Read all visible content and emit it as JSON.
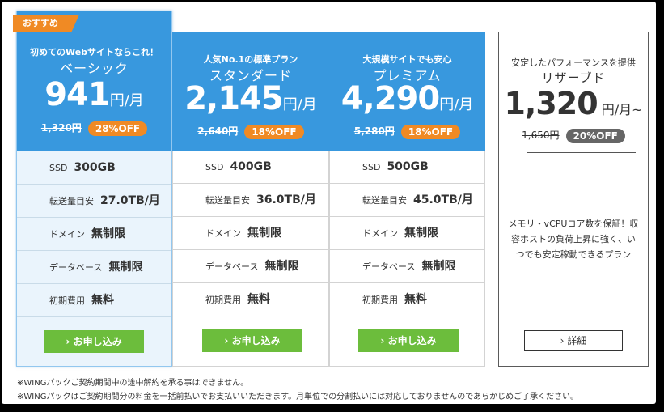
{
  "plans": [
    {
      "badge": "おすすめ",
      "tagline": "初めてのWebサイトならこれ！",
      "name": "ベーシック",
      "price": "941",
      "price_unit": "円/月",
      "old_price": "1,320円",
      "discount": "28%OFF",
      "specs": [
        {
          "label": "SSD",
          "value": "300GB"
        },
        {
          "label": "転送量目安",
          "value": "27.0TB/月"
        },
        {
          "label": "ドメイン",
          "value": "無制限"
        },
        {
          "label": "データベース",
          "value": "無制限"
        },
        {
          "label": "初期費用",
          "value": "無料"
        }
      ],
      "button": "お申し込み"
    },
    {
      "tagline": "人気No.1の標準プラン",
      "name": "スタンダード",
      "price": "2,145",
      "price_unit": "円/月",
      "old_price": "2,640円",
      "discount": "18%OFF",
      "specs": [
        {
          "label": "SSD",
          "value": "400GB"
        },
        {
          "label": "転送量目安",
          "value": "36.0TB/月"
        },
        {
          "label": "ドメイン",
          "value": "無制限"
        },
        {
          "label": "データベース",
          "value": "無制限"
        },
        {
          "label": "初期費用",
          "value": "無料"
        }
      ],
      "button": "お申し込み"
    },
    {
      "tagline": "大規模サイトでも安心",
      "name": "プレミアム",
      "price": "4,290",
      "price_unit": "円/月",
      "old_price": "5,280円",
      "discount": "18%OFF",
      "specs": [
        {
          "label": "SSD",
          "value": "500GB"
        },
        {
          "label": "転送量目安",
          "value": "45.0TB/月"
        },
        {
          "label": "ドメイン",
          "value": "無制限"
        },
        {
          "label": "データベース",
          "value": "無制限"
        },
        {
          "label": "初期費用",
          "value": "無料"
        }
      ],
      "button": "お申し込み"
    }
  ],
  "reserved": {
    "tagline": "安定したパフォーマンスを提供",
    "name": "リザーブド",
    "price": "1,320",
    "price_unit": "円/月~",
    "old_price": "1,650円",
    "discount": "20%OFF",
    "description": "メモリ・vCPUコア数を保証！収容ホストの負荷上昇に強く、いつでも安定稼動できるプラン",
    "button": "詳細"
  },
  "notes": [
    "※WINGパックご契約期間中の途中解約を承る事はできません。",
    "※WINGパックはご契約期間分の料金を一括前払いでお支払いいただきます。月単位での分割払いには対応しておりませんのであらかじめご了承ください。"
  ],
  "colors": {
    "header_blue": "#3898de",
    "discount_orange": "#f08a24",
    "apply_green": "#6cbd3c",
    "reserved_pill": "#666666"
  },
  "icons": {
    "button_arrow": "chevron-right-icon"
  }
}
